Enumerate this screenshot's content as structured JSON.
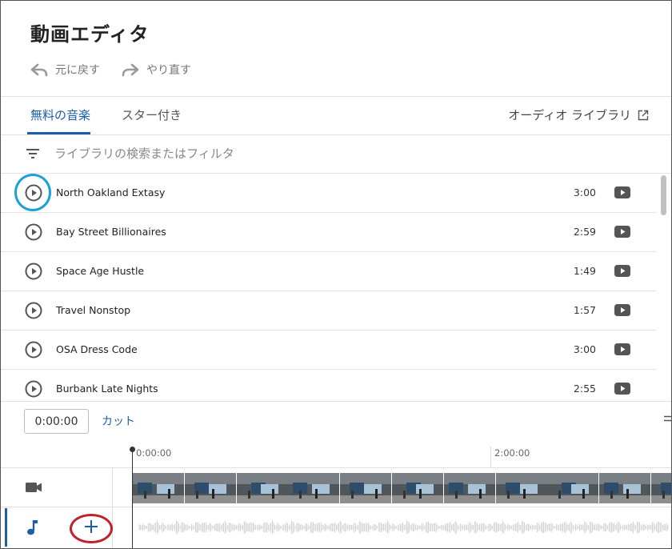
{
  "editor": {
    "title": "動画エディタ",
    "undo_label": "元に戻す",
    "redo_label": "やり直す"
  },
  "tabs": [
    {
      "label": "無料の音楽",
      "active": true
    },
    {
      "label": "スター付き",
      "active": false
    }
  ],
  "audio_library_link": "オーディオ ライブラリ",
  "filter": {
    "placeholder": "ライブラリの検索またはフィルタ"
  },
  "tracks": [
    {
      "title": "North Oakland Extasy",
      "duration": "3:00"
    },
    {
      "title": "Bay Street Billionaires",
      "duration": "2:59"
    },
    {
      "title": "Space Age Hustle",
      "duration": "1:49"
    },
    {
      "title": "Travel Nonstop",
      "duration": "1:57"
    },
    {
      "title": "OSA Dress Code",
      "duration": "3:00"
    },
    {
      "title": "Burbank Late Nights",
      "duration": "2:55"
    }
  ],
  "timeline": {
    "timecode": "0:00:00",
    "cut_label": "カット",
    "ruler": [
      "0:00:00",
      "2:00:00"
    ]
  },
  "colors": {
    "accent": "#1a5fa8",
    "highlight_circle": "#1ba1d6",
    "annotation_circle": "#c0202a"
  }
}
